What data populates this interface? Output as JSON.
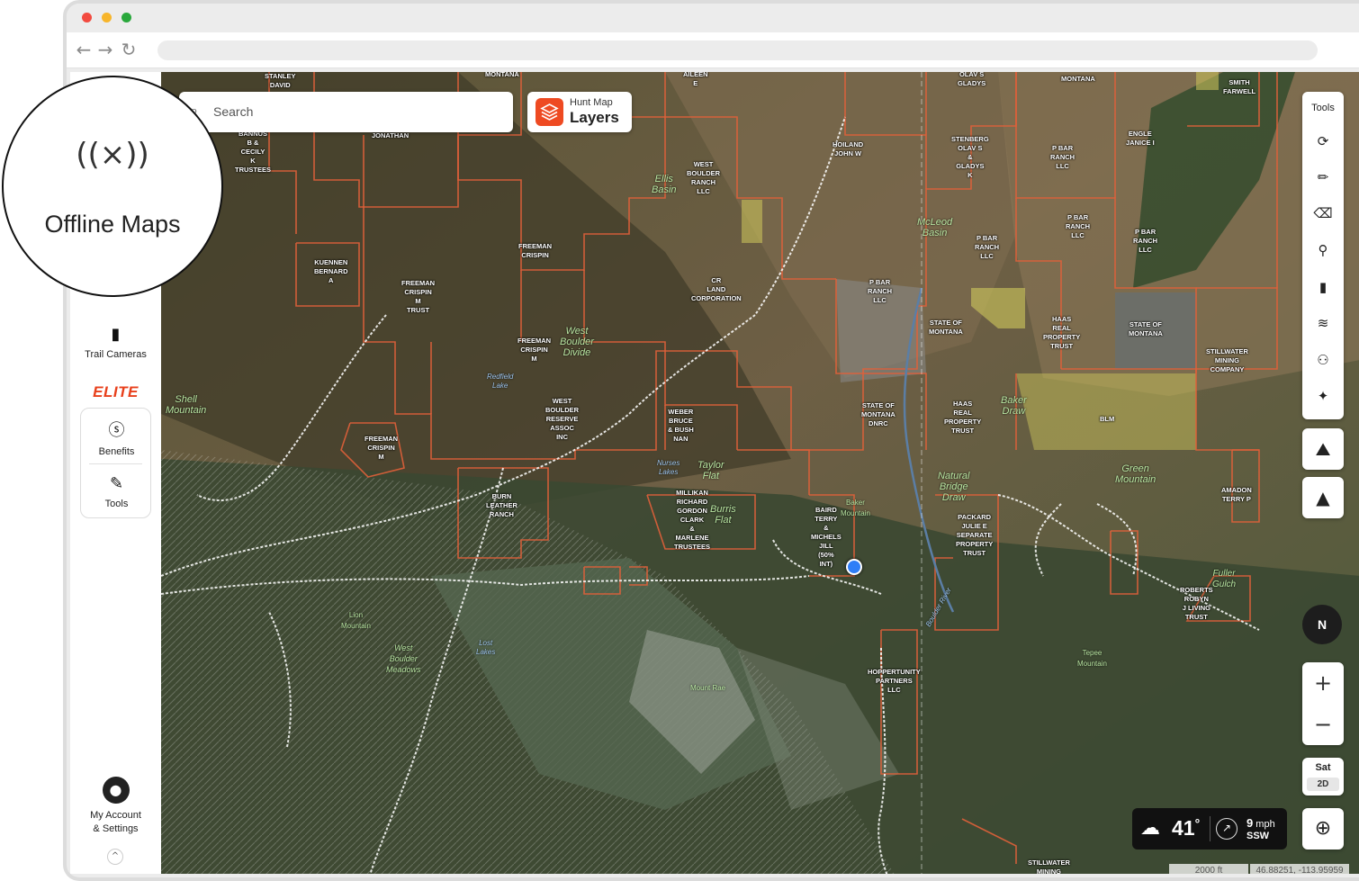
{
  "offline": {
    "label": "Offline Maps",
    "icon": "offline-signal-icon"
  },
  "sidebar": {
    "trail_cameras": "Trail Cameras",
    "elite": "ELITE",
    "benefits": "Benefits",
    "tools": "Tools",
    "account_line1": "My Account",
    "account_line2": "& Settings"
  },
  "search": {
    "placeholder": "Search"
  },
  "layers": {
    "small": "Hunt Map",
    "big": "Layers"
  },
  "tools_panel": {
    "title": "Tools"
  },
  "compass": {
    "label": "N"
  },
  "zoom": {
    "in": "+",
    "out": "−"
  },
  "basemap": {
    "label": "Sat",
    "mode": "2D"
  },
  "weather": {
    "temp": "41",
    "unit": "°",
    "wind_speed": "9",
    "wind_unit": "mph",
    "wind_dir": "SSW"
  },
  "scale": "2000 ft",
  "coords": "46.88251, -113.95959",
  "colors": {
    "brand": "#ee4a22",
    "boundary": "#e0603a",
    "public_land": "#c8c05a",
    "location": "#2f7ef7"
  },
  "owners": [
    {
      "t": "STANLEY\nDAVID"
    },
    {
      "t": "MONTANA"
    },
    {
      "t": "AILEEN\nE"
    },
    {
      "t": "OLAV S\nGLADYS"
    },
    {
      "t": "MONTANA"
    },
    {
      "t": "SMITH\nFARWELL"
    },
    {
      "t": "BANNUS\nB &\nCECILY\nK\nTRUSTEES"
    },
    {
      "t": "JONATHAN"
    },
    {
      "t": "HOILAND\nJOHN W"
    },
    {
      "t": "WEST\nBOULDER\nRANCH\nLLC"
    },
    {
      "t": "STENBERG\nOLAV S\n&\nGLADYS\nK"
    },
    {
      "t": "P BAR\nRANCH\nLLC"
    },
    {
      "t": "ENGLE\nJANICE I"
    },
    {
      "t": "KUENNEN\nBERNARD\nA"
    },
    {
      "t": "FREEMAN\nCRISPIN"
    },
    {
      "t": "FREEMAN\nCRISPIN\nM\nTRUST"
    },
    {
      "t": "CR\nLAND\nCORPORATION"
    },
    {
      "t": "P BAR\nRANCH\nLLC"
    },
    {
      "t": "P BAR\nRANCH\nLLC"
    },
    {
      "t": "P BAR\nRANCH\nLLC"
    },
    {
      "t": "P BAR\nRANCH\nLLC"
    },
    {
      "t": "STATE OF\nMONTANA"
    },
    {
      "t": "HAAS\nREAL\nPROPERTY\nTRUST"
    },
    {
      "t": "STATE OF\nMONTANA"
    },
    {
      "t": "STILLWATER\nMINING\nCOMPANY"
    },
    {
      "t": "FREEMAN\nCRISPIN\nM"
    },
    {
      "t": "WEST\nBOULDER\nRESERVE\nASSOC\nINC"
    },
    {
      "t": "WEBER\nBRUCE\n& BUSH\nNAN"
    },
    {
      "t": "STATE OF\nMONTANA\nDNRC"
    },
    {
      "t": "HAAS\nREAL\nPROPERTY\nTRUST"
    },
    {
      "t": "BLM"
    },
    {
      "t": "FREEMAN\nCRISPIN\nM"
    },
    {
      "t": "BURN\nLEATHER\nRANCH"
    },
    {
      "t": "MILLIKAN\nRICHARD\nGORDON\nCLARK\n&\nMARLENE\nTRUSTEES"
    },
    {
      "t": "BAIRD\nTERRY\n&\nMICHELS\nJILL\n(50%\nINT)"
    },
    {
      "t": "PACKARD\nJULIE E\nSEPARATE\nPROPERTY\nTRUST"
    },
    {
      "t": "AMADON\nTERRY P"
    },
    {
      "t": "ROBERTS\nROBYN\nJ LIVING\nTRUST"
    },
    {
      "t": "HOPPERTUNITY\nPARTNERS\nLLC"
    },
    {
      "t": "STILLWATER\nMINING"
    }
  ],
  "places": [
    {
      "t": "Ellis\nBasin"
    },
    {
      "t": "McLeod\nBasin"
    },
    {
      "t": "West\nBoulder\nDivide"
    },
    {
      "t": "Shell\nMountain"
    },
    {
      "t": "Taylor\nFlat"
    },
    {
      "t": "Burris\nFlat"
    },
    {
      "t": "Baker\nDraw"
    },
    {
      "t": "Green\nMountain"
    },
    {
      "t": "Natural\nBridge\nDraw"
    },
    {
      "t": "Baker\nMountain"
    },
    {
      "t": "Lion\nMountain"
    },
    {
      "t": "West\nBoulder\nMeadows"
    },
    {
      "t": "Mount Rae"
    },
    {
      "t": "Tepee\nMountain"
    },
    {
      "t": "Fuller\nGulch"
    }
  ],
  "waters": [
    {
      "t": "Redfield\nLake"
    },
    {
      "t": "Nurses\nLakes"
    },
    {
      "t": "Lost\nLakes"
    },
    {
      "t": "Boulder River"
    }
  ]
}
